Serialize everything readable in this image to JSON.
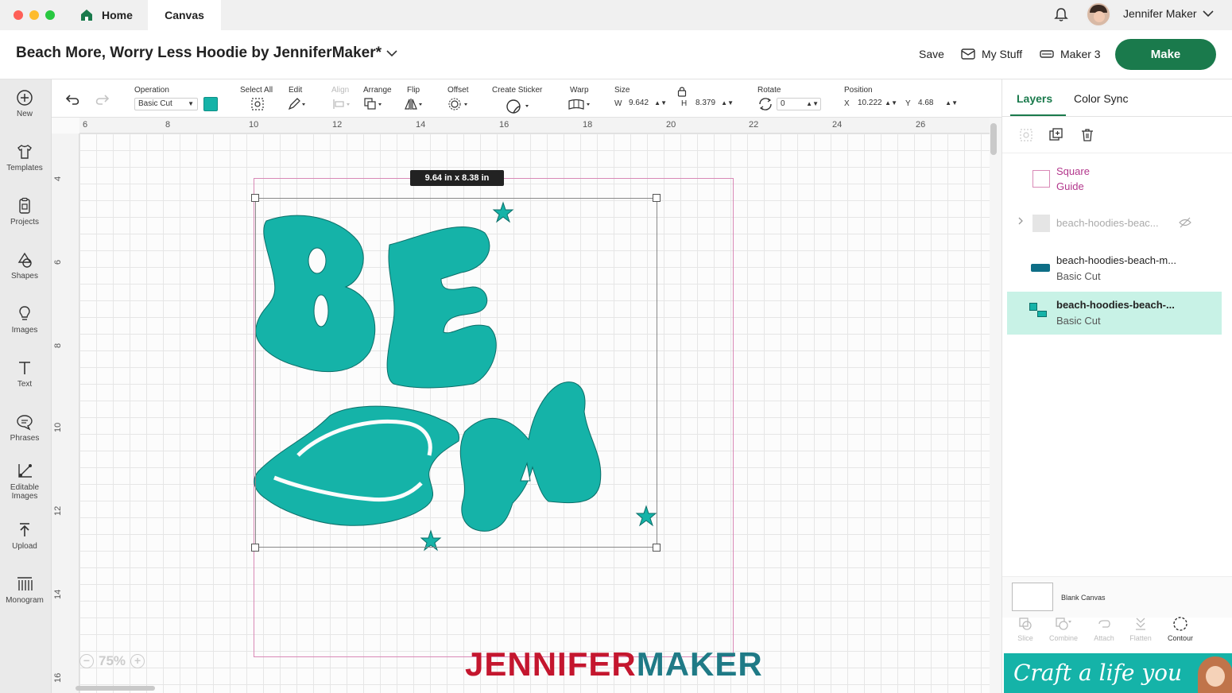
{
  "titlebar": {
    "home_tab": "Home",
    "canvas_tab": "Canvas",
    "user_name": "Jennifer Maker"
  },
  "header": {
    "project_title": "Beach More, Worry Less Hoodie by JenniferMaker*",
    "save": "Save",
    "my_stuff": "My Stuff",
    "machine": "Maker 3",
    "make": "Make"
  },
  "leftbar": {
    "items": [
      {
        "label": "New",
        "icon": "plus-circle-icon"
      },
      {
        "label": "Templates",
        "icon": "shirt-icon"
      },
      {
        "label": "Projects",
        "icon": "clipboard-icon"
      },
      {
        "label": "Shapes",
        "icon": "shapes-icon"
      },
      {
        "label": "Images",
        "icon": "lightbulb-icon"
      },
      {
        "label": "Text",
        "icon": "text-icon"
      },
      {
        "label": "Phrases",
        "icon": "speech-bubble-icon"
      },
      {
        "label": "Editable Images",
        "icon": "editable-images-icon"
      },
      {
        "label": "Upload",
        "icon": "upload-icon"
      },
      {
        "label": "Monogram",
        "icon": "monogram-icon"
      }
    ]
  },
  "edittoolbar": {
    "operation_label": "Operation",
    "operation_value": "Basic Cut",
    "operation_color": "#15b3a8",
    "select_all": "Select All",
    "edit": "Edit",
    "align": "Align",
    "arrange": "Arrange",
    "flip": "Flip",
    "offset": "Offset",
    "create_sticker": "Create Sticker",
    "warp": "Warp",
    "size": "Size",
    "w_label": "W",
    "w_value": "9.642",
    "h_label": "H",
    "h_value": "8.379",
    "rotate": "Rotate",
    "rotate_value": "0",
    "position": "Position",
    "x_label": "X",
    "x_value": "10.222",
    "y_label": "Y",
    "y_value": "4.68"
  },
  "canvas": {
    "ruler_top": [
      "6",
      "8",
      "10",
      "12",
      "14",
      "16",
      "18",
      "20",
      "22",
      "24",
      "26"
    ],
    "ruler_left": [
      "4",
      "6",
      "8",
      "10",
      "12",
      "14",
      "16"
    ],
    "size_tooltip": "9.64  in x 8.38  in",
    "zoom": "75%",
    "watermark_a": "JENNIFER",
    "watermark_b": "MAKER",
    "art_color": "#15b3a8",
    "letters": [
      "B",
      "E",
      "M"
    ]
  },
  "rightpanel": {
    "tab_layers": "Layers",
    "tab_color_sync": "Color Sync",
    "layers": [
      {
        "name": "Square",
        "sub": "Guide"
      },
      {
        "name": "beach-hoodies-beac...",
        "sub": ""
      },
      {
        "name": "beach-hoodies-beach-m...",
        "sub": "Basic Cut"
      },
      {
        "name": "beach-hoodies-beach-...",
        "sub": "Basic Cut"
      }
    ],
    "blank_canvas": "Blank Canvas",
    "bottom_tools": [
      "Slice",
      "Combine",
      "Attach",
      "Flatten",
      "Contour"
    ],
    "banner": "Craft a life you love"
  }
}
